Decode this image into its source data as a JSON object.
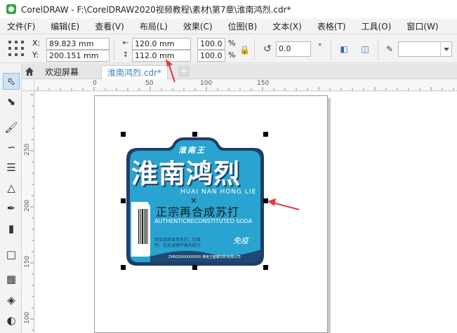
{
  "titlebar": {
    "title": "CorelDRAW - F:\\CorelDRAW2020视频教程\\素材\\第7章\\淮南鸿烈.cdr*"
  },
  "menu": [
    "文件(F)",
    "编辑(E)",
    "查看(V)",
    "布局(L)",
    "效果(C)",
    "位图(B)",
    "文本(X)",
    "表格(T)",
    "工具(O)",
    "窗口(W)"
  ],
  "propbar": {
    "x_label": "X:",
    "x_value": "89.823 mm",
    "y_label": "Y:",
    "y_value": "200.151 mm",
    "width_value": "120.0 mm",
    "height_value": "112.0 mm",
    "scale_w": "100.0",
    "scale_h": "100.0",
    "percent": "%",
    "rotation": "0.0",
    "degree": "°"
  },
  "tabs": {
    "welcome": "欢迎屏幕",
    "document": "淮南鸿烈.cdr*",
    "add": "+"
  },
  "ruler_top": [
    "0",
    "50",
    "100",
    "150"
  ],
  "ruler_left": [
    "250",
    "200",
    "150",
    "100"
  ],
  "artwork": {
    "brand_small": "淮南王",
    "brand_big": "淮南鸿烈",
    "pinyin": "HUAI NAN HONG LIE",
    "slogan": "正宗再合成苏打",
    "english": "AUTHENTICRECONSTITUTED SODA",
    "tag": "免疫",
    "desc_line1": "添加优质食用苏打、防腐",
    "desc_line2": "剂、饮后调理平衡的配方",
    "footer": "ZHNZ0000000000 淮南王健康饮料有限公司"
  },
  "colors": {
    "label_blue": "#29a3cf",
    "label_dark": "#1f3e6a",
    "accent_red": "#e8383d",
    "tab_blue": "#3a7fc4"
  }
}
